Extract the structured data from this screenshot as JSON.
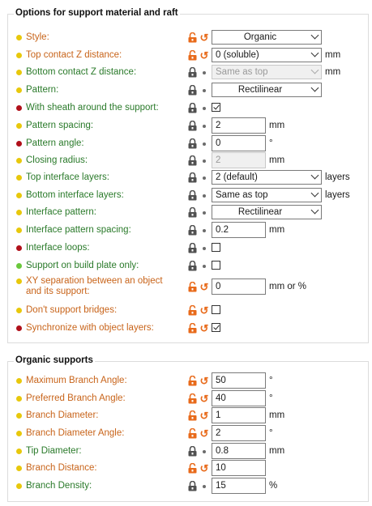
{
  "colors": {
    "green_label": "#2a7a2a",
    "orange_label": "#c8641a",
    "dot_yellow": "#e8c80c",
    "dot_red": "#b0101a",
    "dot_green": "#6ac83c",
    "lock_orange": "#e86a1a",
    "lock_gray": "#505050"
  },
  "support": {
    "title": "Options for support material and raft",
    "rows": [
      {
        "label": "Style:",
        "value": "Organic"
      },
      {
        "label": "Top contact Z distance:",
        "value": "0 (soluble)",
        "unit": "mm"
      },
      {
        "label": "Bottom contact Z distance:",
        "value": "Same as top",
        "unit": "mm"
      },
      {
        "label": "Pattern:",
        "value": "Rectilinear"
      },
      {
        "label": "With sheath around the support:",
        "value": "checked"
      },
      {
        "label": "Pattern spacing:",
        "value": "2",
        "unit": "mm"
      },
      {
        "label": "Pattern angle:",
        "value": "0",
        "unit": "°"
      },
      {
        "label": "Closing radius:",
        "value": "2",
        "unit": "mm"
      },
      {
        "label": "Top interface layers:",
        "value": "2 (default)",
        "unit": "layers"
      },
      {
        "label": "Bottom interface layers:",
        "value": "Same as top",
        "unit": "layers"
      },
      {
        "label": "Interface pattern:",
        "value": "Rectilinear"
      },
      {
        "label": "Interface pattern spacing:",
        "value": "0.2",
        "unit": "mm"
      },
      {
        "label": "Interface loops:",
        "value": "unchecked"
      },
      {
        "label": "Support on build plate only:",
        "value": "unchecked"
      },
      {
        "label": "XY separation between an object and its support:",
        "value": "0",
        "unit": "mm or %"
      },
      {
        "label": "Don't support bridges:",
        "value": "unchecked"
      },
      {
        "label": "Synchronize with object layers:",
        "value": "checked"
      }
    ]
  },
  "organic": {
    "title": "Organic supports",
    "rows": [
      {
        "label": "Maximum Branch Angle:",
        "value": "50",
        "unit": "°"
      },
      {
        "label": "Preferred Branch Angle:",
        "value": "40",
        "unit": "°"
      },
      {
        "label": "Branch Diameter:",
        "value": "1",
        "unit": "mm"
      },
      {
        "label": "Branch Diameter Angle:",
        "value": "2",
        "unit": "°"
      },
      {
        "label": "Tip Diameter:",
        "value": "0.8",
        "unit": "mm"
      },
      {
        "label": "Branch Distance:",
        "value": "10"
      },
      {
        "label": "Branch Density:",
        "value": "15",
        "unit": "%"
      }
    ]
  }
}
